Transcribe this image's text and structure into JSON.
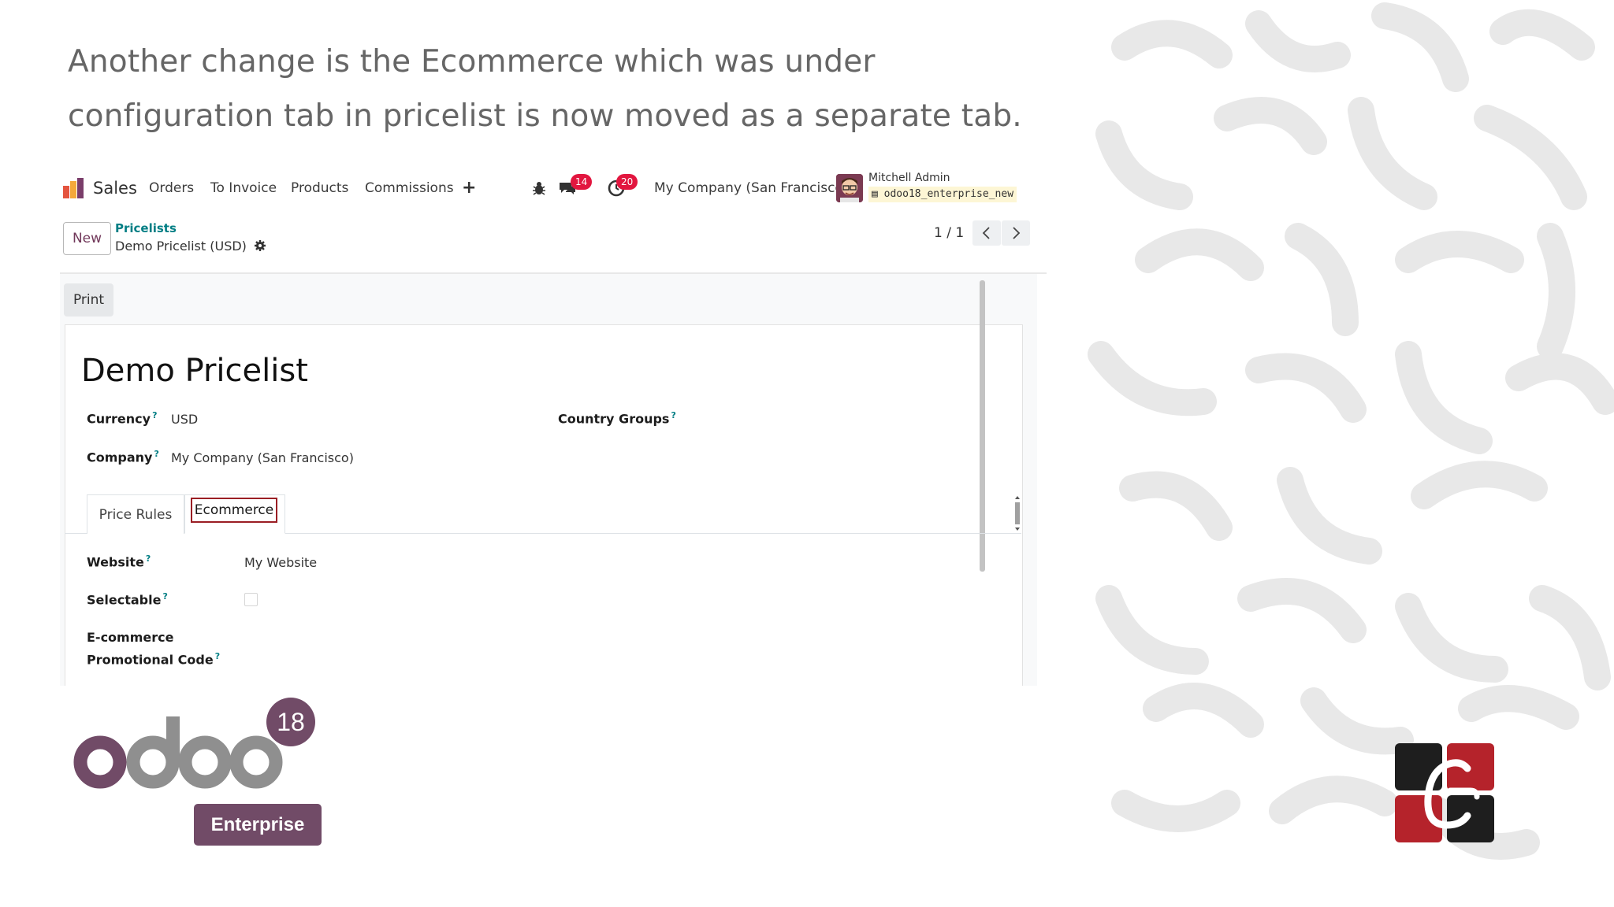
{
  "heading": "Another change is the  Ecommerce which was under configuration tab in pricelist is now moved as a separate tab.",
  "navbar": {
    "app_name": "Sales",
    "menus": [
      "Orders",
      "To Invoice",
      "Products",
      "Commissions"
    ],
    "plus": "+",
    "messages_count": "14",
    "activities_count": "20",
    "company": "My Company (San Francisco)",
    "user_name": "Mitchell Admin",
    "database": "odoo18_enterprise_new"
  },
  "control_panel": {
    "new_label": "New",
    "breadcrumb_parent": "Pricelists",
    "breadcrumb_current": "Demo Pricelist (USD)",
    "pager": "1 / 1"
  },
  "form": {
    "print_label": "Print",
    "title": "Demo Pricelist",
    "currency_label": "Currency",
    "currency_value": "USD",
    "company_label": "Company",
    "company_value": "My Company (San Francisco)",
    "country_groups_label": "Country Groups",
    "help_mark": "?",
    "tabs": [
      "Price Rules",
      "Ecommerce"
    ],
    "active_tab": "Ecommerce",
    "website_label": "Website",
    "website_value": "My Website",
    "selectable_label": "Selectable",
    "selectable_checked": false,
    "promo_label_line1": "E-commerce",
    "promo_label_line2": "Promotional Code"
  },
  "branding": {
    "version": "18",
    "edition": "Enterprise"
  },
  "colors": {
    "odoo_purple": "#714b67",
    "odoo_gray": "#8f8f8f",
    "teal_link": "#017e84",
    "badge_red": "#e2163f",
    "highlight_red": "#9a1e24"
  }
}
